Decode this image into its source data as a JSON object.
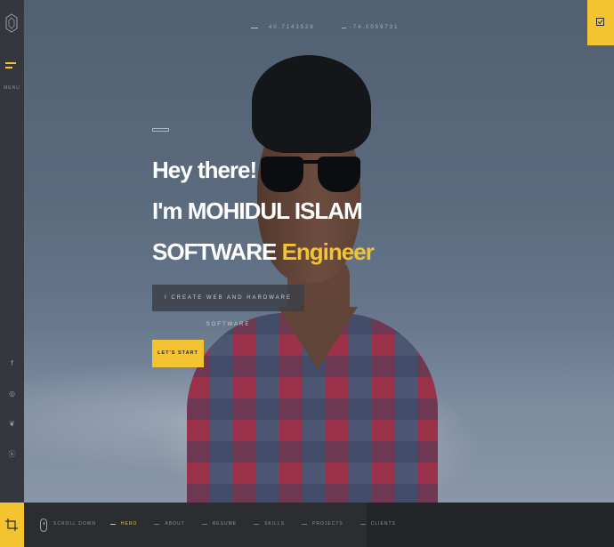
{
  "coords": {
    "lat": "40.7143528",
    "lng": "-74.0059731"
  },
  "rail": {
    "menu_label": "MENU",
    "socials": [
      {
        "icon": "facebook-icon",
        "glyph": "f"
      },
      {
        "icon": "instagram-icon",
        "glyph": "◎"
      },
      {
        "icon": "twitter-icon",
        "glyph": "❦"
      },
      {
        "icon": "vk-icon",
        "glyph": "ⓚ"
      }
    ]
  },
  "hero": {
    "line1": "Hey there!",
    "line2": "I'm MOHIDUL ISLAM",
    "line3_main": "SOFTWARE",
    "line3_accent": "Engineer",
    "tagline": "I CREATE WEB AND HARDWARE SOFTWARE",
    "cta": "LET'S START"
  },
  "bottom": {
    "scroll_label": "SCROLL DOWN",
    "nav": [
      {
        "label": "HERO",
        "active": true
      },
      {
        "label": "ABOUT",
        "active": false
      },
      {
        "label": "RESUME",
        "active": false
      },
      {
        "label": "SKILLS",
        "active": false
      },
      {
        "label": "PROJECTS",
        "active": false
      },
      {
        "label": "CLIENTS",
        "active": false
      }
    ]
  },
  "colors": {
    "accent": "#f4c430",
    "dark": "#2b2d31",
    "rail": "#34373d"
  }
}
